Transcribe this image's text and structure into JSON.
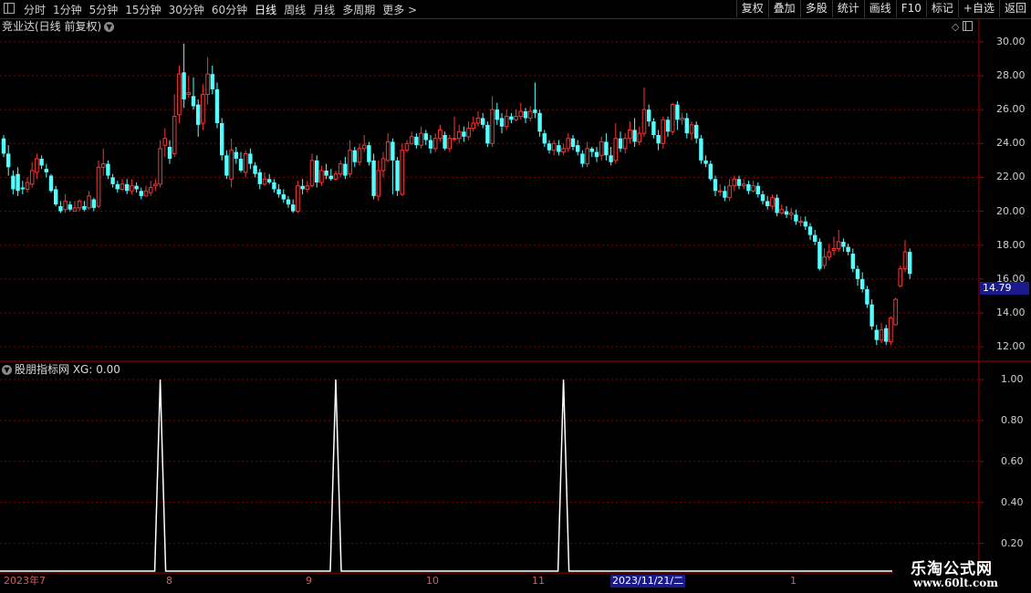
{
  "toolbar": {
    "periods": [
      "分时",
      "1分钟",
      "5分钟",
      "15分钟",
      "30分钟",
      "60分钟",
      "日线",
      "周线",
      "月线",
      "多周期",
      "更多 >"
    ],
    "active_period": "日线",
    "tools": [
      "复权",
      "叠加",
      "多股",
      "统计",
      "画线",
      "F10",
      "标记",
      "+自选",
      "返回"
    ]
  },
  "main_chart": {
    "title": "竞业达(日线 前复权)",
    "last_price": "14.79",
    "y_labels": [
      "30.00",
      "28.00",
      "26.00",
      "24.00",
      "22.00",
      "20.00",
      "18.00",
      "16.00",
      "14.00",
      "12.00"
    ]
  },
  "indicator": {
    "title": "股朋指标网 XG: 0.00",
    "y_labels": [
      "1.00",
      "0.80",
      "0.60",
      "0.40",
      "0.20"
    ]
  },
  "date_axis": {
    "labels": [
      "2023年7",
      "8",
      "9",
      "10",
      "11",
      "1"
    ],
    "highlight": "2023/11/21/二"
  },
  "watermark": {
    "line1": "乐淘公式网",
    "line2": "www.60lt.com"
  },
  "colors": {
    "up": "#ff3232",
    "down": "#54ffff",
    "grid": "#8b0000",
    "panel_border": "#a00000",
    "signal": "#ffffff"
  },
  "chart_data": {
    "type": "candlestick",
    "ylim": [
      11.2,
      30.8
    ],
    "candles": [
      [
        24.3,
        23.4,
        24.5,
        23.2
      ],
      [
        23.4,
        22.6,
        23.9,
        22.1
      ],
      [
        22.1,
        21.3,
        22.4,
        21.0
      ],
      [
        22.2,
        21.2,
        22.6,
        20.9
      ],
      [
        21.4,
        21.3,
        21.8,
        21.0
      ],
      [
        21.3,
        21.7,
        22.0,
        21.1
      ],
      [
        21.6,
        22.4,
        22.9,
        21.4
      ],
      [
        22.3,
        23.1,
        23.4,
        21.9
      ],
      [
        23.1,
        22.7,
        23.3,
        22.5
      ],
      [
        22.5,
        22.3,
        22.8,
        22.0
      ],
      [
        22.1,
        21.2,
        22.2,
        21.1
      ],
      [
        21.3,
        20.4,
        21.5,
        20.3
      ],
      [
        20.3,
        20.0,
        20.6,
        19.9
      ],
      [
        20.1,
        20.6,
        21.0,
        19.9
      ],
      [
        20.4,
        20.1,
        20.6,
        20.0
      ],
      [
        20.0,
        20.2,
        20.6,
        20.0
      ],
      [
        20.2,
        20.6,
        20.7,
        20.0
      ],
      [
        20.3,
        20.1,
        20.6,
        20.0
      ],
      [
        20.2,
        20.9,
        21.2,
        20.1
      ],
      [
        20.7,
        20.2,
        20.8,
        20.0
      ],
      [
        20.3,
        22.6,
        23.0,
        20.2
      ],
      [
        22.6,
        22.8,
        23.7,
        22.1
      ],
      [
        22.8,
        22.1,
        23.0,
        21.9
      ],
      [
        22.0,
        21.6,
        22.2,
        21.4
      ],
      [
        21.6,
        21.3,
        21.8,
        21.1
      ],
      [
        21.3,
        21.6,
        21.9,
        21.2
      ],
      [
        21.6,
        21.2,
        21.9,
        21.0
      ],
      [
        21.2,
        21.5,
        21.9,
        21.0
      ],
      [
        21.5,
        21.3,
        21.7,
        21.1
      ],
      [
        21.2,
        20.9,
        21.4,
        20.7
      ],
      [
        20.9,
        21.2,
        21.5,
        20.9
      ],
      [
        21.1,
        21.4,
        21.8,
        20.9
      ],
      [
        21.5,
        21.6,
        21.9,
        21.2
      ],
      [
        21.6,
        23.7,
        24.2,
        21.4
      ],
      [
        23.9,
        24.3,
        24.9,
        23.2
      ],
      [
        23.8,
        23.1,
        24.2,
        22.8
      ],
      [
        23.4,
        25.6,
        26.9,
        23.2
      ],
      [
        25.7,
        28.1,
        28.6,
        25.2
      ],
      [
        28.2,
        26.6,
        29.9,
        26.1
      ],
      [
        26.9,
        27.0,
        28.0,
        26.7
      ],
      [
        26.8,
        26.2,
        27.9,
        26.0
      ],
      [
        26.3,
        25.1,
        26.6,
        24.4
      ],
      [
        25.2,
        26.9,
        27.5,
        24.8
      ],
      [
        26.9,
        28.1,
        29.1,
        26.3
      ],
      [
        28.1,
        27.2,
        28.6,
        26.9
      ],
      [
        27.2,
        25.2,
        27.6,
        24.9
      ],
      [
        25.2,
        23.3,
        25.5,
        23.0
      ],
      [
        23.3,
        22.1,
        23.6,
        21.9
      ],
      [
        21.9,
        23.6,
        24.3,
        21.4
      ],
      [
        23.5,
        23.1,
        23.8,
        22.8
      ],
      [
        23.1,
        22.4,
        23.5,
        22.3
      ],
      [
        22.3,
        23.4,
        23.6,
        22.0
      ],
      [
        23.4,
        22.8,
        23.7,
        22.5
      ],
      [
        22.7,
        22.2,
        22.9,
        22.0
      ],
      [
        22.3,
        21.6,
        22.5,
        21.3
      ],
      [
        21.6,
        21.9,
        22.3,
        21.5
      ],
      [
        21.9,
        21.7,
        22.2,
        21.6
      ],
      [
        21.7,
        21.3,
        21.9,
        21.1
      ],
      [
        21.3,
        21.0,
        21.6,
        20.8
      ],
      [
        21.0,
        20.7,
        21.3,
        20.5
      ],
      [
        20.7,
        20.4,
        20.9,
        20.2
      ],
      [
        20.4,
        20.0,
        20.7,
        19.9
      ],
      [
        20.0,
        21.5,
        21.8,
        19.9
      ],
      [
        21.5,
        21.3,
        21.9,
        21.0
      ],
      [
        21.3,
        21.5,
        21.8,
        21.1
      ],
      [
        21.5,
        23.0,
        23.4,
        21.4
      ],
      [
        23.0,
        21.7,
        23.3,
        21.4
      ],
      [
        21.7,
        22.4,
        22.7,
        21.5
      ],
      [
        22.4,
        22.1,
        22.8,
        21.9
      ],
      [
        22.1,
        21.9,
        22.5,
        21.8
      ],
      [
        21.9,
        22.2,
        22.4,
        21.8
      ],
      [
        22.2,
        22.8,
        23.0,
        22.0
      ],
      [
        22.8,
        22.1,
        23.2,
        21.9
      ],
      [
        22.2,
        23.6,
        24.2,
        22.0
      ],
      [
        23.6,
        22.9,
        23.8,
        22.6
      ],
      [
        22.9,
        23.7,
        24.0,
        22.7
      ],
      [
        23.7,
        23.9,
        24.5,
        23.5
      ],
      [
        23.9,
        22.9,
        24.1,
        22.7
      ],
      [
        23.0,
        20.9,
        23.4,
        20.7
      ],
      [
        20.9,
        22.4,
        23.0,
        20.6
      ],
      [
        22.4,
        23.1,
        23.5,
        22.0
      ],
      [
        23.0,
        24.1,
        24.6,
        22.9
      ],
      [
        24.1,
        23.0,
        24.3,
        21.0
      ],
      [
        23.0,
        21.2,
        23.2,
        20.9
      ],
      [
        21.0,
        23.6,
        24.0,
        20.9
      ],
      [
        23.6,
        24.0,
        24.2,
        23.5
      ],
      [
        24.0,
        24.4,
        24.7,
        23.9
      ],
      [
        24.4,
        23.9,
        24.6,
        23.7
      ],
      [
        23.9,
        24.6,
        25.0,
        23.7
      ],
      [
        24.6,
        24.2,
        24.8,
        23.9
      ],
      [
        24.2,
        23.7,
        24.5,
        23.4
      ],
      [
        23.7,
        24.3,
        24.6,
        23.5
      ],
      [
        24.3,
        24.8,
        25.1,
        24.1
      ],
      [
        24.5,
        23.7,
        24.7,
        23.6
      ],
      [
        23.7,
        24.3,
        24.5,
        23.5
      ],
      [
        24.3,
        24.3,
        25.6,
        24.1
      ],
      [
        24.3,
        24.7,
        25.1,
        24.0
      ],
      [
        24.7,
        24.4,
        25.0,
        24.1
      ],
      [
        24.4,
        24.9,
        25.3,
        24.2
      ],
      [
        24.9,
        25.2,
        25.6,
        24.7
      ],
      [
        25.2,
        25.5,
        25.9,
        25.0
      ],
      [
        25.5,
        25.1,
        25.8,
        24.9
      ],
      [
        25.1,
        24.0,
        25.3,
        23.8
      ],
      [
        24.0,
        26.0,
        26.8,
        23.8
      ],
      [
        26.0,
        25.4,
        26.4,
        25.1
      ],
      [
        25.5,
        25.0,
        25.8,
        24.6
      ],
      [
        25.0,
        25.6,
        26.0,
        24.8
      ],
      [
        25.6,
        25.4,
        25.8,
        25.2
      ],
      [
        25.4,
        25.6,
        26.0,
        25.3
      ],
      [
        25.6,
        25.9,
        26.4,
        25.4
      ],
      [
        25.9,
        25.5,
        26.1,
        25.2
      ],
      [
        25.5,
        25.9,
        26.2,
        25.3
      ],
      [
        26.0,
        25.8,
        27.6,
        25.5
      ],
      [
        25.8,
        24.7,
        26.0,
        24.4
      ],
      [
        24.6,
        24.0,
        24.8,
        23.8
      ],
      [
        24.0,
        23.6,
        24.2,
        23.4
      ],
      [
        23.6,
        24.0,
        24.2,
        23.3
      ],
      [
        23.9,
        23.5,
        24.2,
        23.3
      ],
      [
        23.5,
        23.7,
        24.0,
        23.3
      ],
      [
        23.7,
        24.3,
        24.6,
        23.5
      ],
      [
        24.3,
        23.8,
        24.5,
        23.6
      ],
      [
        23.9,
        23.5,
        24.2,
        23.3
      ],
      [
        23.4,
        22.8,
        23.6,
        22.6
      ],
      [
        22.8,
        23.7,
        24.1,
        22.6
      ],
      [
        23.7,
        23.5,
        23.8,
        23.2
      ],
      [
        23.5,
        23.2,
        23.8,
        22.9
      ],
      [
        23.3,
        24.1,
        24.4,
        23.0
      ],
      [
        24.1,
        23.3,
        24.6,
        23.0
      ],
      [
        23.3,
        22.9,
        23.8,
        22.7
      ],
      [
        23.0,
        24.3,
        25.2,
        22.8
      ],
      [
        24.3,
        23.7,
        24.7,
        23.5
      ],
      [
        23.7,
        24.3,
        24.6,
        23.4
      ],
      [
        24.3,
        24.8,
        25.3,
        24.0
      ],
      [
        24.8,
        24.1,
        25.5,
        23.8
      ],
      [
        24.1,
        24.6,
        25.0,
        23.9
      ],
      [
        24.6,
        26.0,
        27.3,
        24.4
      ],
      [
        26.0,
        25.3,
        26.3,
        25.0
      ],
      [
        25.3,
        24.5,
        25.5,
        24.3
      ],
      [
        24.5,
        24.0,
        24.8,
        23.6
      ],
      [
        24.0,
        25.4,
        25.6,
        23.7
      ],
      [
        25.4,
        24.7,
        25.6,
        24.4
      ],
      [
        24.7,
        26.3,
        26.4,
        24.5
      ],
      [
        26.3,
        25.4,
        26.5,
        24.8
      ],
      [
        25.4,
        25.5,
        25.8,
        25.1
      ],
      [
        25.5,
        24.6,
        25.8,
        24.3
      ],
      [
        24.6,
        25.1,
        25.3,
        24.2
      ],
      [
        25.1,
        24.3,
        25.3,
        24.0
      ],
      [
        24.3,
        23.0,
        24.5,
        22.8
      ],
      [
        23.0,
        22.8,
        23.3,
        22.6
      ],
      [
        22.8,
        21.9,
        23.0,
        21.8
      ],
      [
        21.9,
        21.2,
        22.1,
        20.9
      ],
      [
        21.2,
        21.2,
        21.6,
        20.9
      ],
      [
        21.2,
        20.8,
        21.5,
        20.6
      ],
      [
        20.8,
        21.5,
        21.9,
        20.6
      ],
      [
        21.5,
        21.9,
        22.1,
        21.2
      ],
      [
        21.9,
        21.5,
        22.1,
        21.3
      ],
      [
        21.5,
        21.6,
        21.9,
        21.3
      ],
      [
        21.6,
        21.2,
        21.8,
        21.0
      ],
      [
        21.2,
        21.5,
        21.8,
        21.1
      ],
      [
        21.5,
        21.0,
        21.7,
        20.8
      ],
      [
        21.0,
        20.6,
        21.2,
        20.4
      ],
      [
        20.6,
        20.3,
        20.9,
        20.1
      ],
      [
        20.3,
        20.8,
        21.0,
        20.1
      ],
      [
        20.8,
        19.9,
        21.0,
        19.7
      ],
      [
        19.9,
        20.1,
        20.4,
        19.8
      ],
      [
        20.0,
        19.8,
        20.3,
        19.6
      ],
      [
        19.8,
        19.9,
        20.2,
        19.5
      ],
      [
        19.8,
        19.4,
        20.1,
        19.2
      ],
      [
        19.4,
        19.4,
        19.7,
        19.1
      ],
      [
        19.4,
        19.1,
        19.7,
        18.9
      ],
      [
        19.1,
        18.6,
        19.3,
        18.3
      ],
      [
        18.6,
        18.2,
        18.9,
        18.0
      ],
      [
        18.2,
        16.6,
        18.4,
        16.5
      ],
      [
        16.8,
        17.3,
        17.8,
        16.6
      ],
      [
        17.3,
        17.6,
        18.1,
        17.1
      ],
      [
        17.7,
        17.8,
        18.5,
        17.4
      ],
      [
        17.8,
        18.2,
        18.9,
        17.6
      ],
      [
        18.2,
        17.9,
        18.4,
        17.6
      ],
      [
        17.9,
        17.6,
        18.1,
        17.4
      ],
      [
        17.5,
        16.6,
        17.8,
        16.4
      ],
      [
        16.6,
        16.0,
        16.8,
        15.6
      ],
      [
        16.0,
        15.4,
        16.4,
        15.2
      ],
      [
        15.4,
        14.5,
        15.6,
        14.3
      ],
      [
        14.5,
        13.2,
        14.8,
        13.0
      ],
      [
        13.0,
        12.4,
        13.3,
        12.1
      ],
      [
        12.4,
        13.0,
        13.4,
        12.2
      ],
      [
        13.1,
        12.3,
        13.3,
        12.1
      ],
      [
        12.3,
        13.7,
        13.8,
        12.1
      ],
      [
        13.3,
        14.8,
        14.9,
        13.3
      ],
      [
        15.6,
        16.6,
        16.8,
        15.5
      ],
      [
        16.6,
        17.6,
        18.3,
        16.4
      ],
      [
        17.6,
        16.3,
        17.8,
        16.0
      ]
    ],
    "indicator": {
      "ylim": [
        0,
        1
      ],
      "spike_candle_index": [
        33,
        70,
        118
      ],
      "spike_value": 1.0,
      "baseline": 0.0
    }
  }
}
